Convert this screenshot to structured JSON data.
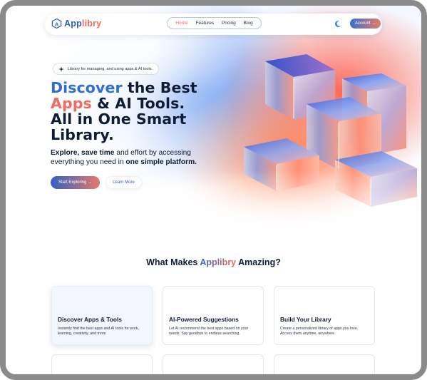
{
  "brand": {
    "name_part1": "App",
    "name_part2": "libry",
    "colors": {
      "blue": "#2f62c2",
      "coral": "#ef6b5d",
      "navy": "#0e1c36"
    }
  },
  "nav": {
    "links": [
      "Home",
      "Features",
      "Pricing",
      "Blog"
    ],
    "active": "Home",
    "theme_icon": "moon-icon",
    "account_label": "Account →"
  },
  "hero": {
    "badge_icon": "sparkle-icon",
    "badge_text": "Library for managing, and using apps & AI tools.",
    "title_word1": "Discover",
    "title_rest1": " the Best",
    "title_word2": "Apps",
    "title_rest2": " & AI Tools.",
    "title_line3": "All in One Smart",
    "title_line4": "Library.",
    "sub_bold1": "Explore, save time",
    "sub_mid": " and effort by accessing everything you need in ",
    "sub_bold2": "one simple platform.",
    "primary_button": "Start Exploring →",
    "secondary_button": "Learn More"
  },
  "features": {
    "title_before": "What Makes ",
    "title_accent": "Applibry",
    "title_after": " Amazing?",
    "cards": [
      {
        "title": "Discover Apps & Tools",
        "desc": "Instantly find the best apps and AI tools for work, learning, creativity, and more"
      },
      {
        "title": "AI-Powered Suggestions",
        "desc": "Let AI recommend the best apps based on your needs. Say goodbye to endless searching."
      },
      {
        "title": "Build Your Library",
        "desc": "Create a personalized library of apps you love. Access them anytime, anywhere."
      }
    ]
  }
}
